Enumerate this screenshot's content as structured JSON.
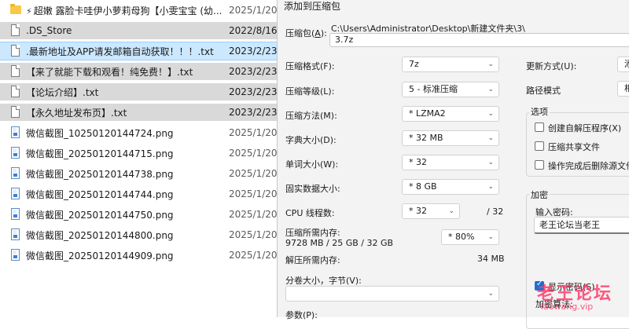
{
  "explorer": {
    "files": [
      {
        "name": "超嫩 露脸卡哇伊小萝莉母狗【小雯宝宝 (幼...",
        "date": "2025/1/20",
        "kind": "folder",
        "bolt": true
      },
      {
        "name": ".DS_Store",
        "date": "2022/8/16",
        "kind": "doc"
      },
      {
        "name": ".最新地址及APP请发邮箱自动获取！！！.txt",
        "date": "2023/2/23",
        "kind": "doc"
      },
      {
        "name": "【来了就能下载和观看！纯免费！】.txt",
        "date": "2023/2/23",
        "kind": "doc"
      },
      {
        "name": "【论坛介绍】.txt",
        "date": "2023/2/23",
        "kind": "doc"
      },
      {
        "name": "【永久地址发布页】.txt",
        "date": "2023/2/23",
        "kind": "doc"
      },
      {
        "name": "微信截图_10250120144724.png",
        "date": "2025/1/20",
        "kind": "img"
      },
      {
        "name": "微信截图_20250120144715.png",
        "date": "2025/1/20",
        "kind": "img"
      },
      {
        "name": "微信截图_20250120144738.png",
        "date": "2025/1/20",
        "kind": "img"
      },
      {
        "name": "微信截图_20250120144744.png",
        "date": "2025/1/20",
        "kind": "img"
      },
      {
        "name": "微信截图_20250120144750.png",
        "date": "2025/1/20",
        "kind": "img"
      },
      {
        "name": "微信截图_20250120144800.png",
        "date": "2025/1/20",
        "kind": "img"
      },
      {
        "name": "微信截图_20250120144909.png",
        "date": "2025/1/20",
        "kind": "img"
      }
    ]
  },
  "dialog": {
    "title": "添加到压缩包",
    "archive_label": "压缩包(",
    "archive_key": "A",
    "archive_label_end": "):",
    "archive_path": "C:\\Users\\Administrator\\Desktop\\新建文件夹\\3\\",
    "archive_name": "3.7z",
    "format_label": "压缩格式(F):",
    "format_value": "7z",
    "level_label": "压缩等级(L):",
    "level_value": "5 - 标准压缩",
    "method_label": "压缩方法(M):",
    "method_value": "*  LZMA2",
    "dict_label": "字典大小(D):",
    "dict_value": "*  32 MB",
    "word_label": "单词大小(W):",
    "word_value": "*  32",
    "solid_label": "固实数据大小:",
    "solid_value": "*  8 GB",
    "threads_label": "CPU 线程数:",
    "threads_value": "*  32",
    "threads_total": "/ 32",
    "mem_label": "压缩所需内存:",
    "mem_value": "9728 MB / 25 GB / 32 GB",
    "mem_pct": "*  80%",
    "unmem_label": "解压所需内存:",
    "unmem_value": "34 MB",
    "split_label": "分卷大小，字节(V):",
    "params_label": "参数(P):",
    "update_label": "更新方式(U):",
    "update_value": "添",
    "path_label": "路径模式",
    "path_value": "相",
    "options_title": "选项",
    "opt_sfx": "创建自解压程序(X)",
    "opt_shared": "压缩共享文件",
    "opt_delete": "操作完成后删除源文件",
    "enc_title": "加密",
    "pwd_label": "输入密码:",
    "pwd_value": "老王论坛当老王",
    "show_pwd": "显示密码(S)",
    "enc_method": "加密算法:"
  },
  "watermark": {
    "text": "老王论坛",
    "url": "laowang.vip"
  }
}
